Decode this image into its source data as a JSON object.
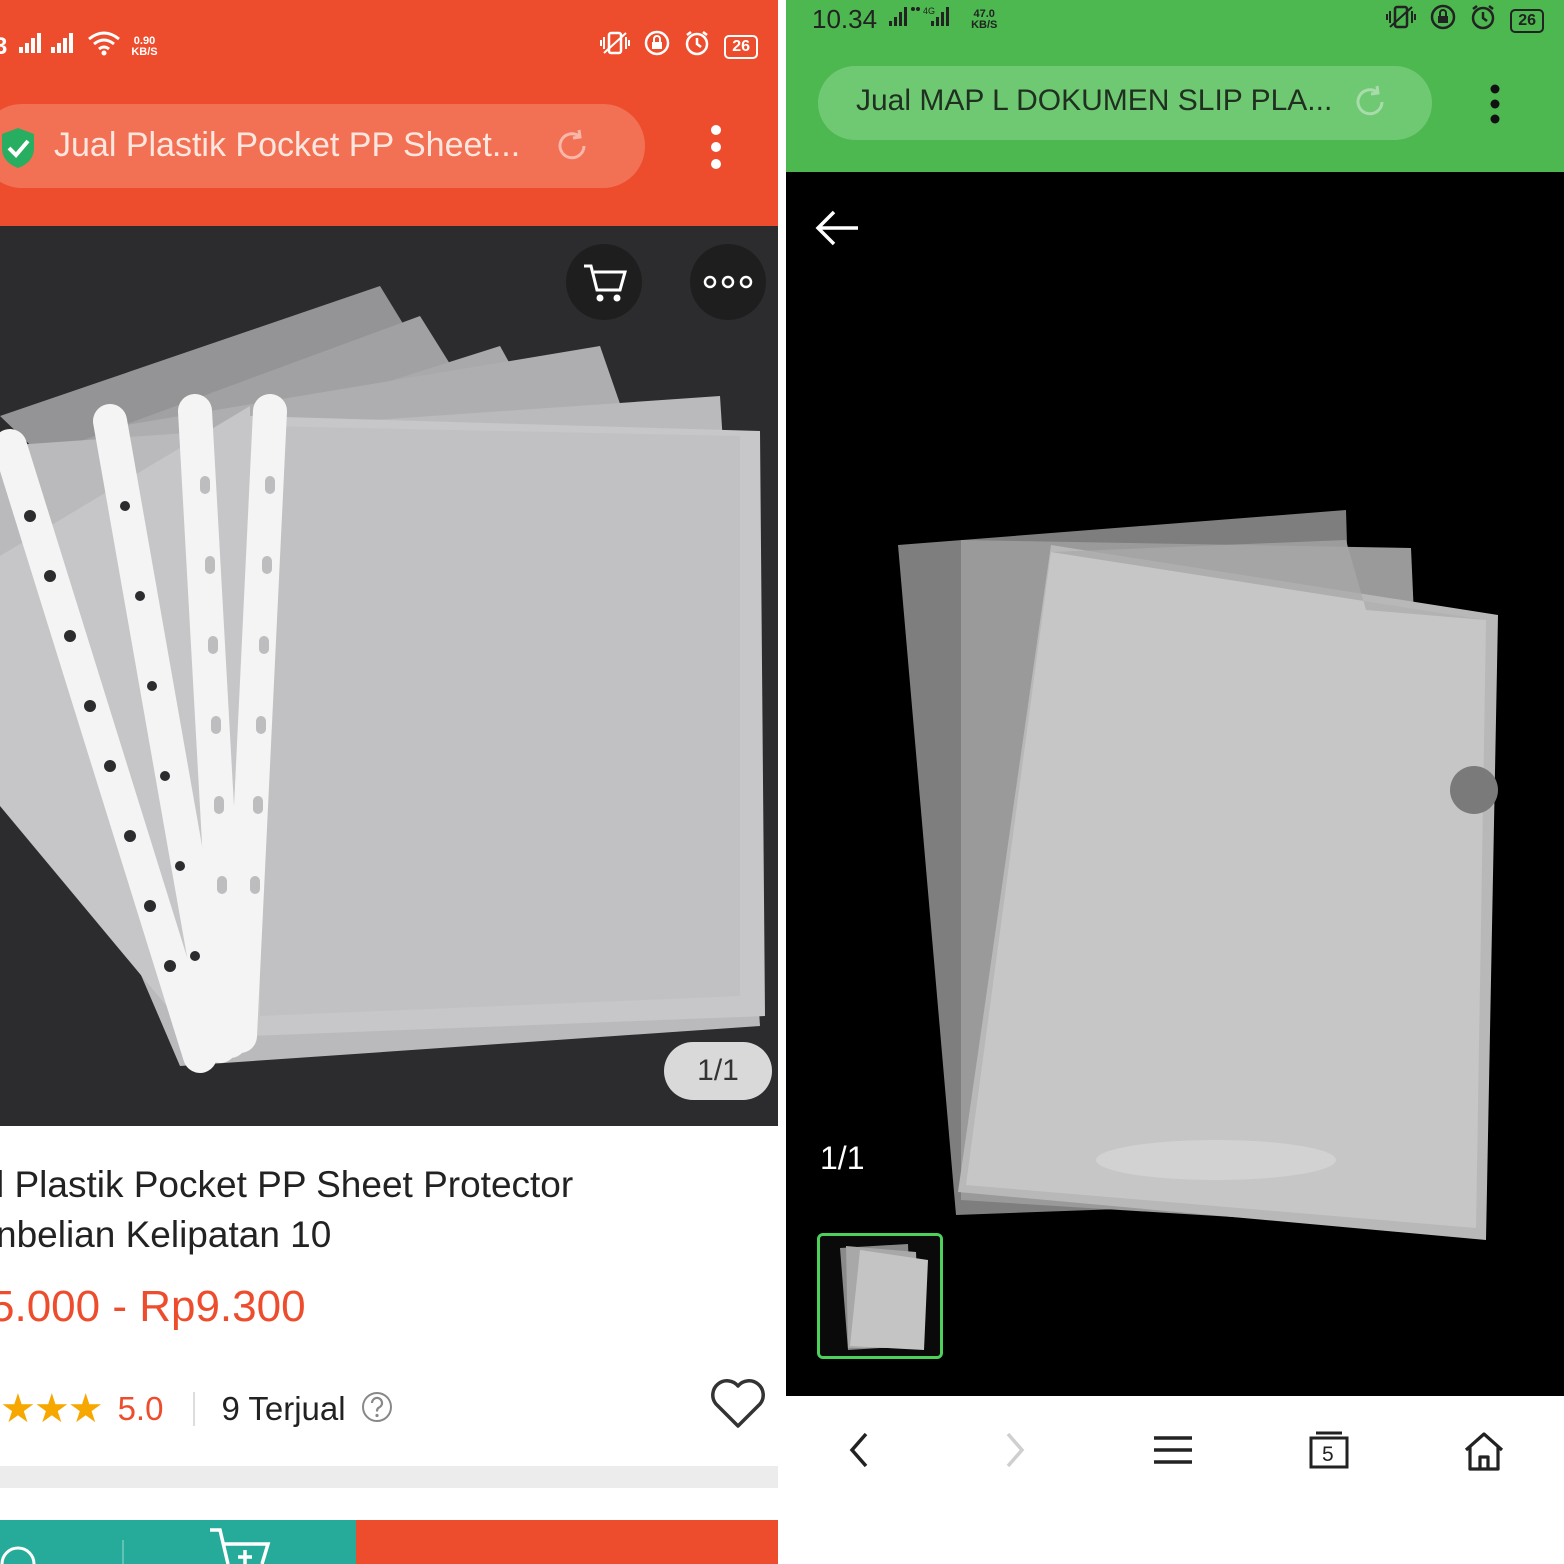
{
  "left": {
    "status": {
      "carrier": "3",
      "speed": "0.90",
      "speed_unit": "KB/S",
      "battery": "26"
    },
    "url_title": "Jual Plastik Pocket PP Sheet...",
    "image_counter": "1/1",
    "product": {
      "title_line1": "l Plastik Pocket PP Sheet Protector",
      "title_line2": "nbelian Kelipatan 10",
      "price": "5.000 - Rp9.300",
      "rating": "5.0",
      "sold": "9 Terjual"
    },
    "icons": [
      "shield-check-icon",
      "reload-icon",
      "kebab-menu-icon",
      "cart-icon",
      "more-icon",
      "star-icon",
      "help-icon",
      "heart-icon",
      "chat-icon",
      "add-cart-icon"
    ],
    "colors": {
      "brand": "#ee4d2d",
      "teal": "#26aa99",
      "star": "#f6a700"
    }
  },
  "right": {
    "status": {
      "time": "10.34",
      "speed": "47.0",
      "speed_unit": "KB/S",
      "battery": "26"
    },
    "url_title": "Jual MAP L DOKUMEN SLIP PLA...",
    "image_counter": "1/1",
    "tabs_count": "5",
    "icons": [
      "back-arrow-icon",
      "reload-icon",
      "kebab-menu-icon",
      "nav-back-icon",
      "nav-forward-icon",
      "menu-icon",
      "tabs-icon",
      "home-icon"
    ],
    "colors": {
      "brand": "#4cb84f",
      "thumb_border": "#4cd25a"
    }
  }
}
